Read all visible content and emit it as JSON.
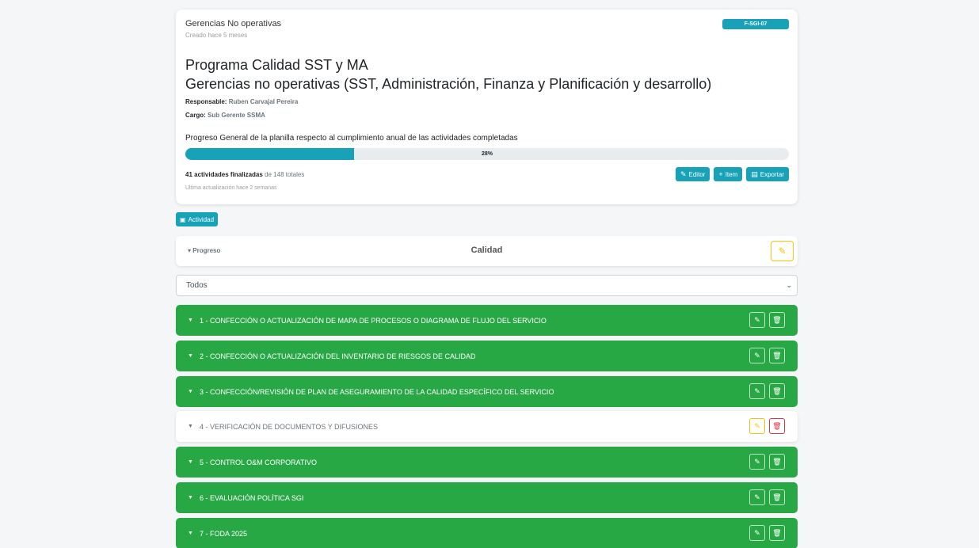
{
  "header": {
    "owner": "Gerencias No operativas",
    "created": "Creado hace 5 meses",
    "code": "F-SGI-07",
    "title_line1": "Programa Calidad SST y MA",
    "title_line2": "Gerencias no operativas (SST, Administración, Finanza y Planificación y desarrollo)",
    "responsible_label": "Responsable:",
    "responsible_value": "Ruben Carvajal Pereira",
    "cargo_label": "Cargo:",
    "cargo_value": "Sub Gerente SSMA",
    "progress_description": "Progreso General de la planilla respecto al cumplimiento anual de las actividades completadas",
    "progress_percent": 28,
    "progress_label": "28%",
    "finished_text": "41 actividades finalizadas",
    "total_text": "de 148 totales",
    "updated": "Ultima actualización hace 2 semanas",
    "buttons": {
      "editor": "Editor",
      "item": "Item",
      "export": "Exportar"
    }
  },
  "activity_button": "Actividad",
  "progress_panel": {
    "toggle_label": "Progreso",
    "title": "Calidad"
  },
  "filter": {
    "selected": "Todos"
  },
  "colors": {
    "info": "#17a2b8",
    "success": "#28a745",
    "warning": "#ffc107",
    "danger": "#dc3545"
  },
  "items": [
    {
      "label": "1 - CONFECCIÓN O ACTUALIZACIÓN DE MAPA DE PROCESOS O DIAGRAMA DE FLUJO DEL SERVICIO",
      "status": "complete"
    },
    {
      "label": "2 - CONFECCIÓN O ACTUALIZACIÓN DEL INVENTARIO DE RIESGOS DE CALIDAD",
      "status": "complete"
    },
    {
      "label": "3 - CONFECCIÓN/REVISIÓN DE PLAN DE ASEGURAMIENTO DE LA CALIDAD ESPECÍFICO DEL SERVICIO",
      "status": "complete"
    },
    {
      "label": "4 - VERIFICACIÓN DE DOCUMENTOS Y DIFUSIONES",
      "status": "pending"
    },
    {
      "label": "5 - CONTROL O&M CORPORATIVO",
      "status": "complete"
    },
    {
      "label": "6 - EVALUACIÓN POLÍTICA SGI",
      "status": "complete"
    },
    {
      "label": "7 - FODA 2025",
      "status": "complete"
    }
  ]
}
